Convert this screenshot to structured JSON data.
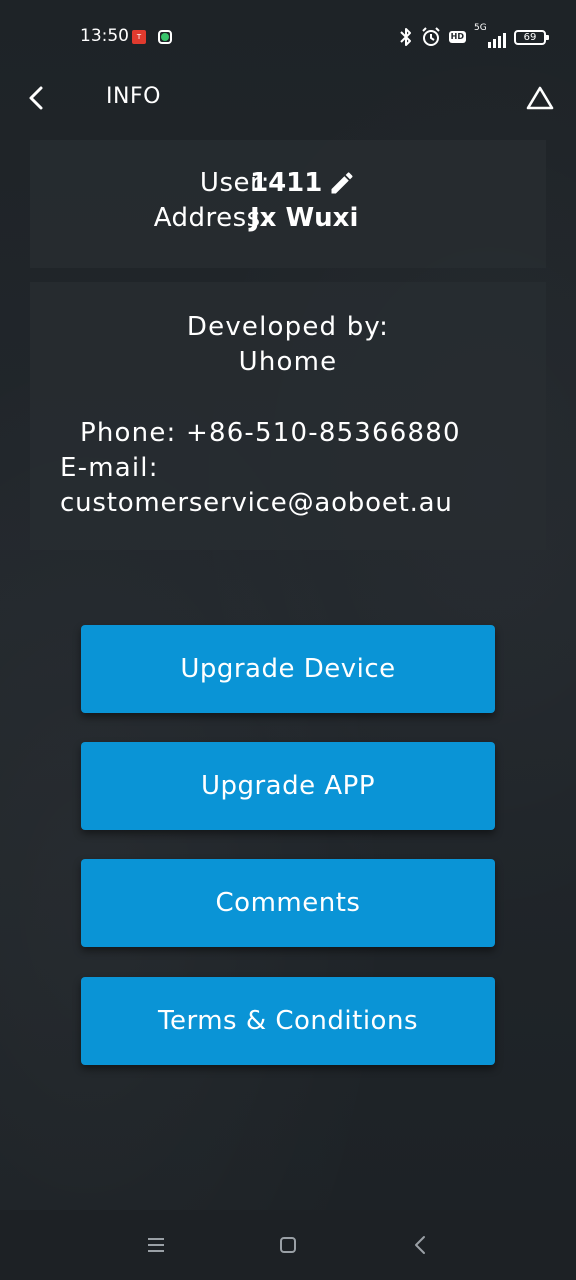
{
  "status_bar": {
    "time": "13:50",
    "network": "5G",
    "battery": "69",
    "hd": "HD"
  },
  "header": {
    "title": "INFO"
  },
  "user_card": {
    "user_label": "User:",
    "user_value": "1411",
    "address_label": "Address:",
    "address_value": "Jx Wuxi"
  },
  "developer_card": {
    "developed_by_label": "Developed by:",
    "developer_name": "Uhome",
    "phone": "Phone: +86-510-85366880",
    "email_label": "E-mail:",
    "email": "customerservice@aoboet.au"
  },
  "buttons": {
    "upgrade_device": "Upgrade Device",
    "upgrade_app": "Upgrade APP",
    "comments": "Comments",
    "terms": "Terms & Conditions"
  },
  "colors": {
    "background": "#1f2428",
    "card": "#282d32",
    "button": "#0a94d6",
    "text": "#ffffff"
  },
  "icons": {
    "back": "chevron-left-icon",
    "alert": "warning-triangle-icon",
    "edit": "pencil-icon",
    "nav_menu": "menu-icon",
    "nav_home": "home-square-icon",
    "nav_back": "nav-back-icon"
  }
}
